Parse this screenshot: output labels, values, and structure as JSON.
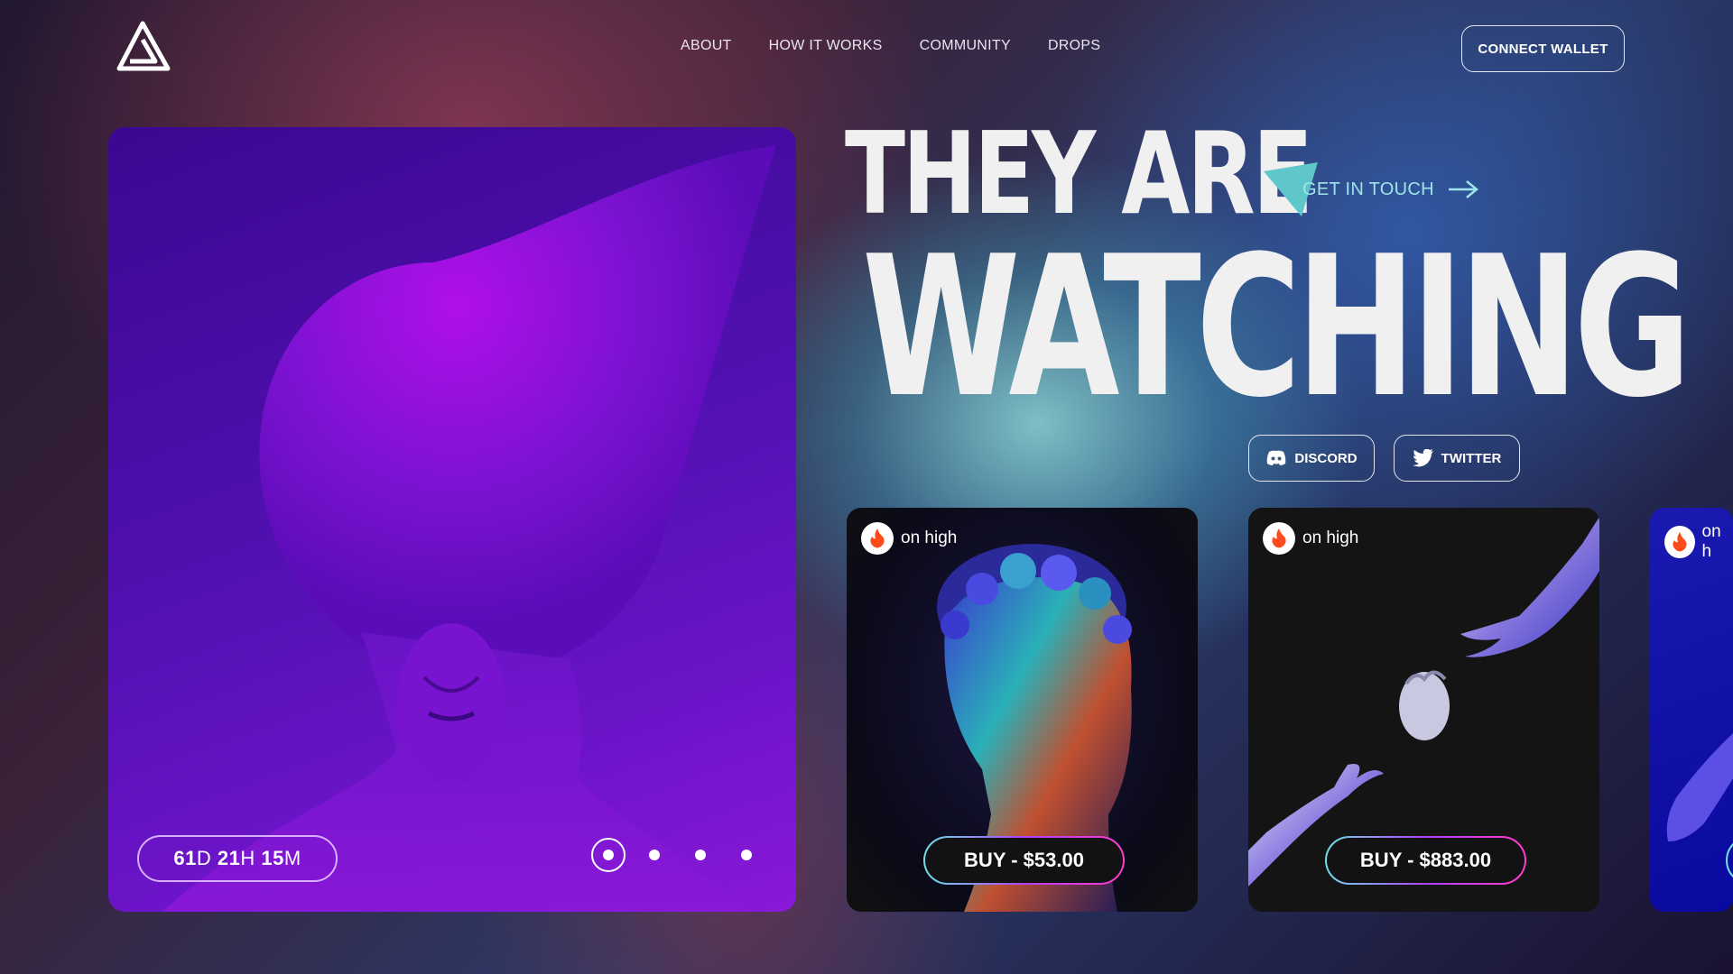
{
  "header": {
    "nav": [
      "ABOUT",
      "HOW IT WORKS",
      "COMMUNITY",
      "DROPS"
    ],
    "wallet_label": "CONNECT WALLET"
  },
  "hero": {
    "timer": {
      "days": "61",
      "days_unit": "D",
      "hours": "21",
      "hours_unit": "H",
      "minutes": "15",
      "minutes_unit": "M"
    },
    "slides": 4,
    "active_slide": 1
  },
  "headline": {
    "line1": "THEY ARE",
    "line2": "WATCHING"
  },
  "contact_label": "GET IN TOUCH",
  "social": {
    "discord": "DISCORD",
    "twitter": "TWITTER"
  },
  "cards": [
    {
      "tag": "on high",
      "buy": "BUY - $53.00"
    },
    {
      "tag": "on high",
      "buy": "BUY - $883.00"
    },
    {
      "tag": "on h"
    }
  ],
  "colors": {
    "accent_teal": "#6fd0d6",
    "hero_purple": "#5a10b8",
    "fire": "#ff4a1c"
  }
}
